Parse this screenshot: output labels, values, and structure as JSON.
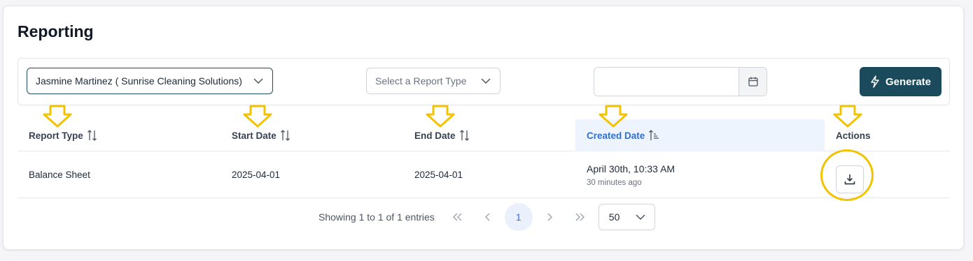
{
  "page": {
    "title": "Reporting"
  },
  "filters": {
    "customer": "Jasmine Martinez ( Sunrise Cleaning Solutions)",
    "report_type_placeholder": "Select a Report Type",
    "date_value": "",
    "generate_label": "Generate",
    "icons": {
      "chevron": "chevron-down-icon",
      "calendar": "calendar-icon",
      "generate": "lightning-bolt-icon"
    }
  },
  "table": {
    "headers": [
      "Report Type",
      "Start Date",
      "End Date",
      "Created Date",
      "Actions"
    ],
    "active_sort_column": "Created Date",
    "rows": [
      {
        "report_type": "Balance Sheet",
        "start_date": "2025-04-01",
        "end_date": "2025-04-01",
        "created": "April 30th, 10:33 AM",
        "created_relative": "30 minutes ago",
        "action_icon": "download-icon"
      }
    ]
  },
  "pagination": {
    "summary": "Showing 1 to 1 of 1 entries",
    "current_page": "1",
    "page_size": "50"
  },
  "colors": {
    "accent": "#1b4a5c",
    "active_header": "#2f6fd6",
    "annotation": "#f3c200"
  }
}
